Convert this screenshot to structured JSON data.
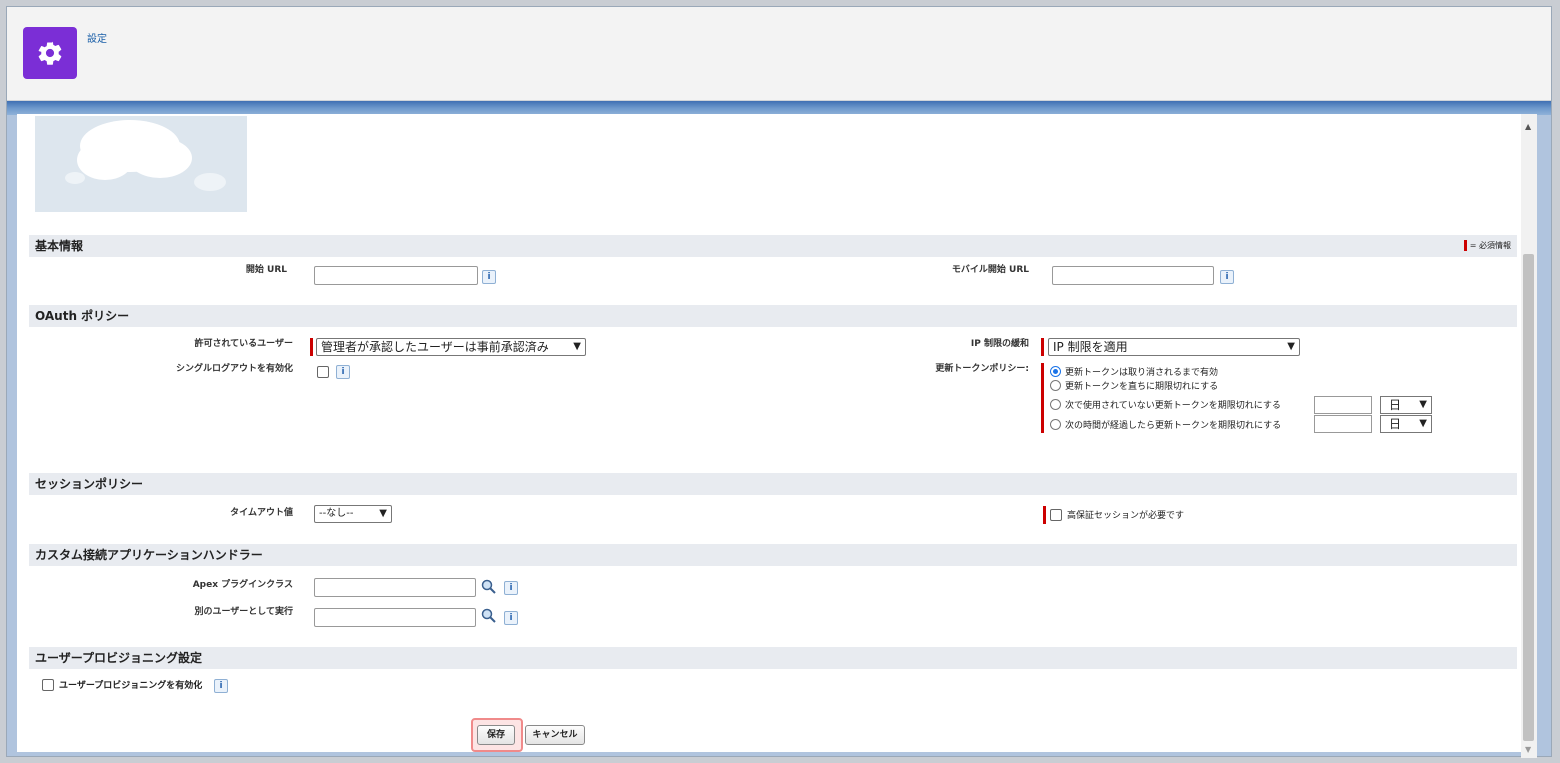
{
  "header": {
    "title": "設定"
  },
  "colors": {
    "accent": "#7b2ed6",
    "required": "#cc0000",
    "link": "#1a5fa8"
  },
  "sections": {
    "basic": {
      "title": "基本情報",
      "required_legend": "= 必須情報"
    },
    "oauth": {
      "title": "OAuth ポリシー"
    },
    "session": {
      "title": "セッションポリシー"
    },
    "custom_handler": {
      "title": "カスタム接続アプリケーションハンドラー"
    },
    "provisioning": {
      "title": "ユーザープロビジョニング設定"
    }
  },
  "basic": {
    "start_url_label": "開始 URL",
    "mobile_start_url_label": "モバイル開始 URL"
  },
  "oauth": {
    "permitted_users_label": "許可されているユーザー",
    "permitted_users_value": "管理者が承認したユーザーは事前承認済み",
    "ip_relax_label": "IP 制限の緩和",
    "ip_relax_value": "IP 制限を適用",
    "single_logout_label": "シングルログアウトを有効化",
    "refresh_policy_label": "更新トークンポリシー:",
    "refresh_options": [
      "更新トークンは取り消されるまで有効",
      "更新トークンを直ちに期限切れにする",
      "次で使用されていない更新トークンを期限切れにする",
      "次の時間が経過したら更新トークンを期限切れにする"
    ],
    "unit_value": "日"
  },
  "session": {
    "timeout_label": "タイムアウト値",
    "timeout_value": "--なし--",
    "high_assurance_label": "高保証セッションが必要です"
  },
  "custom_handler": {
    "apex_label": "Apex プラグインクラス",
    "run_as_label": "別のユーザーとして実行"
  },
  "provisioning": {
    "enable_label": "ユーザープロビジョニングを有効化"
  },
  "buttons": {
    "save": "保存",
    "cancel": "キャンセル"
  }
}
